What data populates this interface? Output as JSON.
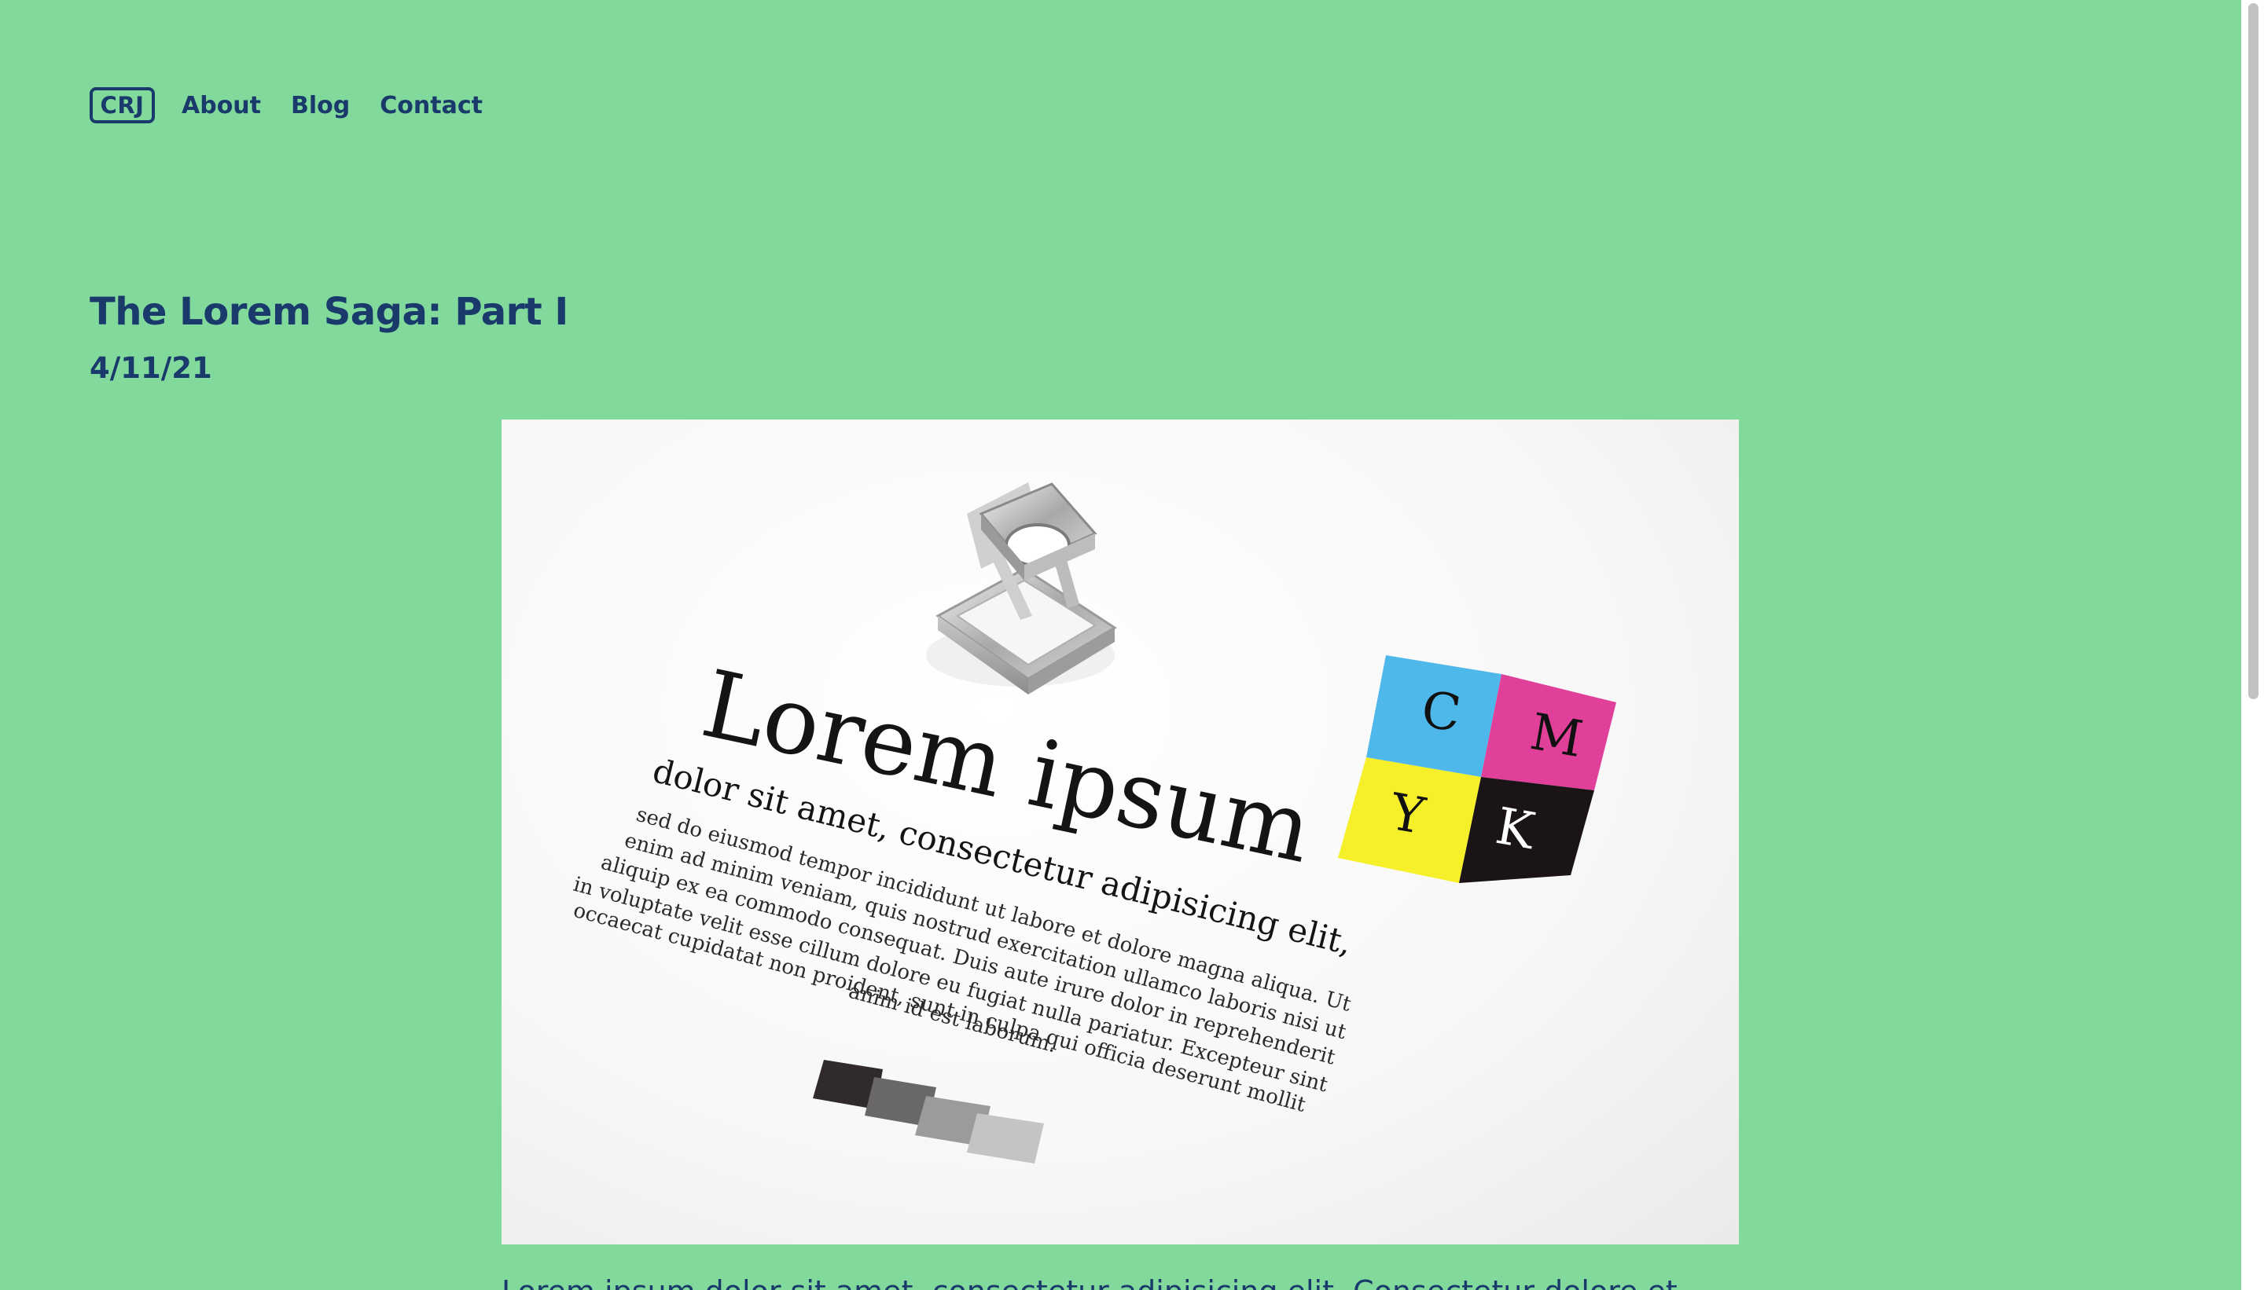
{
  "nav": {
    "logo": "CRJ",
    "items": [
      {
        "label": "About"
      },
      {
        "label": "Blog"
      },
      {
        "label": "Contact"
      }
    ]
  },
  "post": {
    "title": "The Lorem Saga: Part I",
    "date": "4/11/21",
    "body_partial": "Lorem ipsum dolor sit amet, consectetur adipisicing elit. Consectetur dolore et..."
  },
  "hero_image": {
    "headline": "Lorem ipsum",
    "subline": "dolor sit amet, consectetur adipisicing elit,",
    "paragraph": [
      "sed do eiusmod tempor incididunt ut labore et dolore magna aliqua. Ut",
      "enim ad minim veniam, quis nostrud exercitation ullamco laboris nisi ut",
      "aliquip ex ea commodo consequat. Duis aute irure dolor in reprehenderit",
      "in voluptate velit esse cillum dolore eu fugiat nulla pariatur. Excepteur sint",
      "occaecat cupidatat non proident, sunt in culpa qui officia deserunt mollit",
      "anim id est laborum."
    ],
    "cmyk": {
      "c": "C",
      "m": "M",
      "y": "Y",
      "k": "K"
    }
  },
  "colors": {
    "background": "#81d99c",
    "text": "#193a6a",
    "cyan": "#4fb8ea",
    "magenta": "#e0409a",
    "yellow": "#f5f02a",
    "black": "#1a1416"
  }
}
